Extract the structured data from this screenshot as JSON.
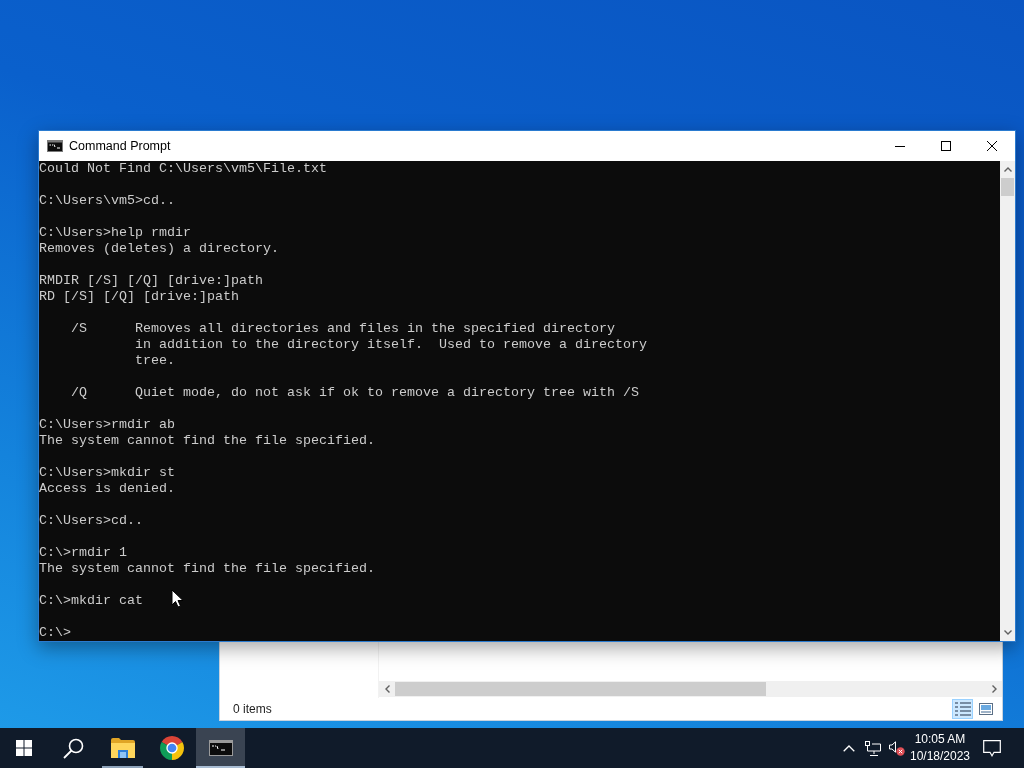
{
  "console_window": {
    "title": "Command Prompt",
    "blocks": [
      {
        "kind": "text",
        "lines": [
          "Could Not Find C:\\Users\\vm5\\File.txt"
        ]
      },
      {
        "kind": "text",
        "lines": [
          "C:\\Users\\vm5>cd.."
        ]
      },
      {
        "kind": "text",
        "lines": [
          "C:\\Users>help rmdir",
          "Removes (deletes) a directory."
        ]
      },
      {
        "kind": "text",
        "lines": [
          "RMDIR [/S] [/Q] [drive:]path",
          "RD [/S] [/Q] [drive:]path"
        ]
      },
      {
        "kind": "option",
        "flag": "/S",
        "lines": [
          "Removes all directories and files in the specified directory",
          "in addition to the directory itself.  Used to remove a directory",
          "tree."
        ]
      },
      {
        "kind": "option",
        "flag": "/Q",
        "lines": [
          "Quiet mode, do not ask if ok to remove a directory tree with /S"
        ]
      },
      {
        "kind": "text",
        "lines": [
          "C:\\Users>rmdir ab",
          "The system cannot find the file specified."
        ]
      },
      {
        "kind": "text",
        "lines": [
          "C:\\Users>mkdir st",
          "Access is denied."
        ]
      },
      {
        "kind": "text",
        "lines": [
          "C:\\Users>cd.."
        ]
      },
      {
        "kind": "text",
        "lines": [
          "C:\\>rmdir 1",
          "The system cannot find the file specified."
        ]
      },
      {
        "kind": "text",
        "lines": [
          "C:\\>mkdir cat"
        ]
      },
      {
        "kind": "text",
        "lines": [
          "C:\\>"
        ]
      }
    ]
  },
  "explorer_window": {
    "status": "0 items",
    "view_buttons": [
      {
        "kind": "details",
        "selected": true
      },
      {
        "kind": "preview",
        "selected": false
      }
    ]
  },
  "taskbar": {
    "apps": [
      {
        "kind": "file_explorer",
        "open": true,
        "selected": false
      },
      {
        "kind": "browser",
        "open": false,
        "selected": false
      },
      {
        "kind": "command_prompt",
        "open": true,
        "selected": true
      }
    ],
    "tray": {
      "muted": true,
      "time": "10:05 AM",
      "date": "10/18/2023"
    }
  }
}
